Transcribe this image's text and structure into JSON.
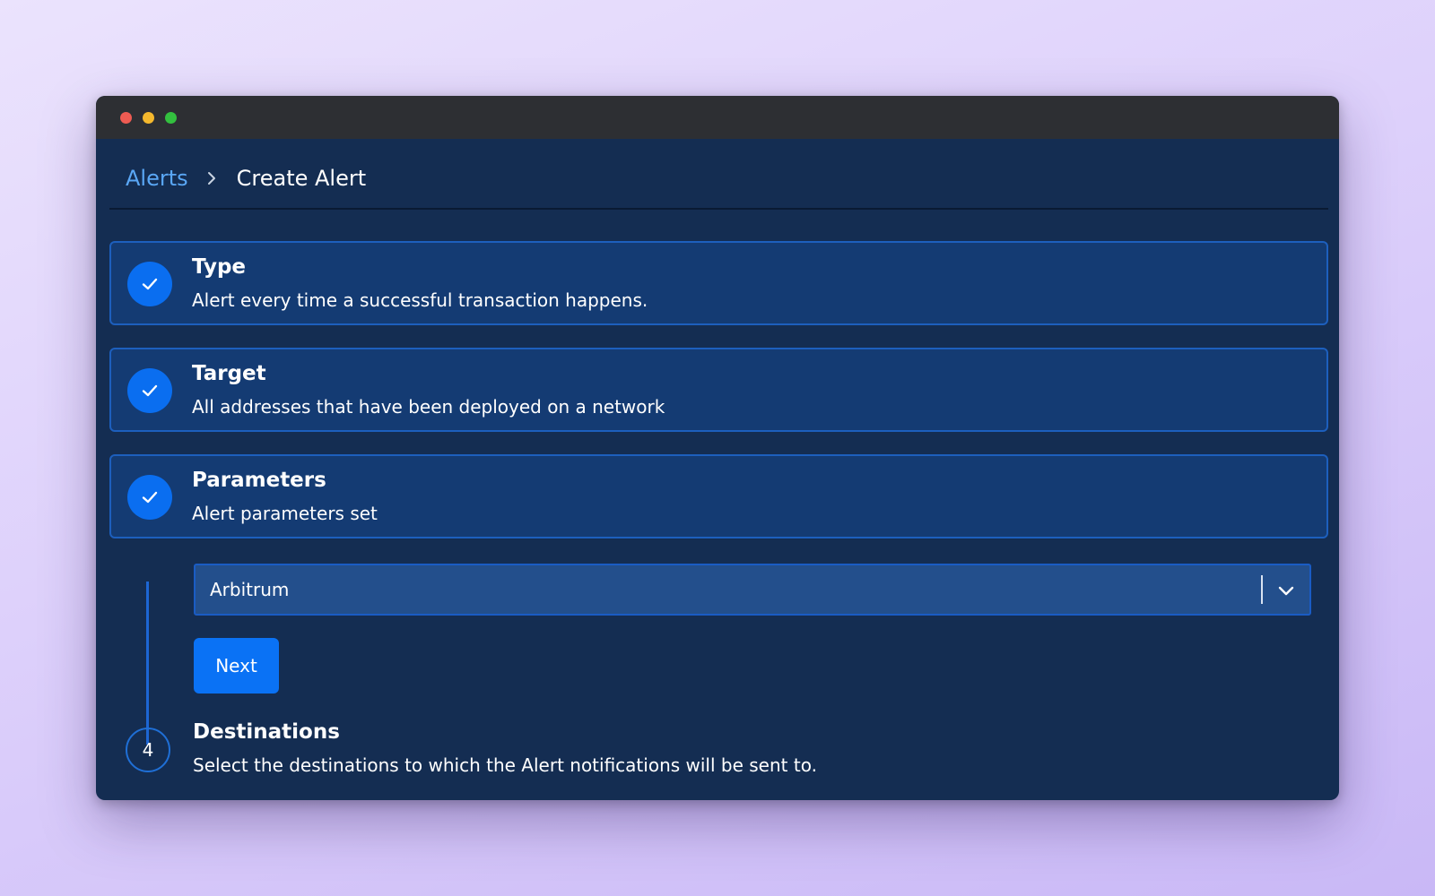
{
  "window": {
    "controls": [
      "close",
      "minimize",
      "maximize"
    ]
  },
  "breadcrumb": {
    "parent": "Alerts",
    "current": "Create Alert",
    "separator_icon": "chevron-right-icon"
  },
  "steps": [
    {
      "title": "Type",
      "description": "Alert every time a successful transaction happens.",
      "status": "completed",
      "icon": "check-icon"
    },
    {
      "title": "Target",
      "description": "All addresses that have been deployed on a network",
      "status": "completed",
      "icon": "check-icon"
    },
    {
      "title": "Parameters",
      "description": "Alert parameters set",
      "status": "completed",
      "icon": "check-icon"
    },
    {
      "number": "4",
      "title": "Destinations",
      "description": "Select the destinations to which the Alert notifications will be sent to.",
      "status": "pending"
    }
  ],
  "parameters": {
    "network_select": {
      "value": "Arbitrum",
      "icon": "chevron-down-icon"
    },
    "next_label": "Next"
  },
  "colors": {
    "background": "#142d52",
    "card": "#143b73",
    "accent": "#0a72f5",
    "link": "#5aa7f5",
    "titlebar": "#2d2f33"
  }
}
